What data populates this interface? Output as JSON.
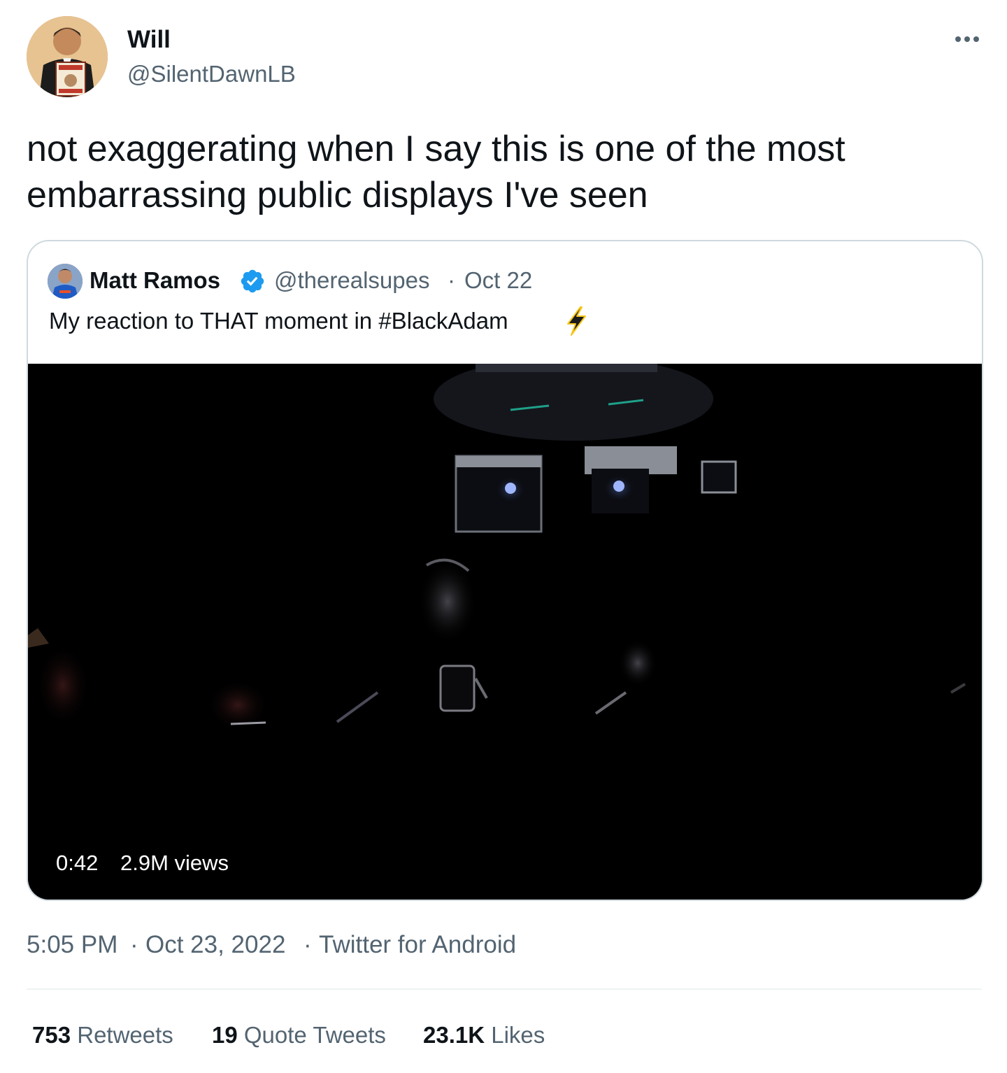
{
  "author": {
    "name": "Will",
    "handle": "@SilentDawnLB"
  },
  "icons": {
    "more": "more-options-icon",
    "verified": "verified-badge-icon",
    "emoji": "lightning-bolt-emoji"
  },
  "tweet": {
    "text": "not exaggerating when I say this is one of the most embarrassing public displays I've seen"
  },
  "quoted": {
    "name": "Matt Ramos",
    "handle": "@therealsupes",
    "separator": "·",
    "date": "Oct 22",
    "text": "My reaction to THAT moment in #BlackAdam",
    "video": {
      "duration": "0:42",
      "views": "2.9M views"
    }
  },
  "meta": {
    "time": "5:05 PM",
    "separator": "·",
    "date": "Oct 23, 2022",
    "source": "Twitter for Android"
  },
  "stats": {
    "retweets": {
      "count": "753",
      "label": "Retweets"
    },
    "quotes": {
      "count": "19",
      "label": "Quote Tweets"
    },
    "likes": {
      "count": "23.1K",
      "label": "Likes"
    }
  },
  "colors": {
    "text_primary": "#0f1419",
    "text_secondary": "#536471",
    "border": "#cfd9de",
    "verified_blue": "#1d9bf0",
    "video_bg": "#000000"
  }
}
